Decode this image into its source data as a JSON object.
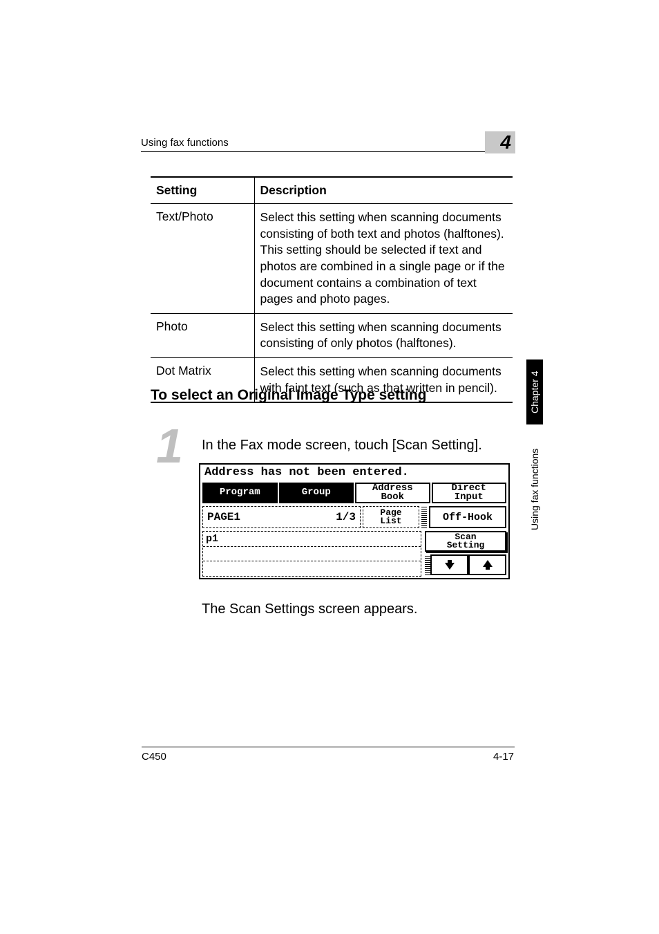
{
  "header": {
    "section_title": "Using fax functions",
    "chapter_number": "4"
  },
  "side": {
    "chapter_label": "Chapter 4",
    "section_label": "Using fax functions"
  },
  "settings_table": {
    "col1": "Setting",
    "col2": "Description",
    "rows": [
      {
        "name": "Text/Photo",
        "desc": "Select this setting when scanning documents consisting of both text and photos (halftones). This setting should be selected if text and photos are combined in a single page or if the document contains a combination of text pages and photo pages."
      },
      {
        "name": "Photo",
        "desc": "Select this setting when scanning documents consisting of only photos (halftones)."
      },
      {
        "name": "Dot Matrix",
        "desc": "Select this setting when scanning documents with faint text (such as that written in pencil)."
      }
    ]
  },
  "section_heading": "To select an Original Image Type setting",
  "step": {
    "num": "1",
    "text": "In the Fax mode screen, touch [Scan Setting].",
    "after": "The Scan Settings screen appears."
  },
  "lcd": {
    "status": "Address has not been entered.",
    "tabs": {
      "program": "Program",
      "group": "Group",
      "address_book": "Address\nBook",
      "direct_input": "Direct\nInput"
    },
    "page_label": "PAGE1",
    "page_count": "1/3",
    "page_list": "Page\nList",
    "off_hook": "Off-Hook",
    "list": {
      "row1": "p1",
      "row2": "",
      "row3": ""
    },
    "scan_setting": "Scan\nSetting",
    "arrow_down": "↓",
    "arrow_up": "↑"
  },
  "footer": {
    "model": "C450",
    "page": "4-17"
  }
}
